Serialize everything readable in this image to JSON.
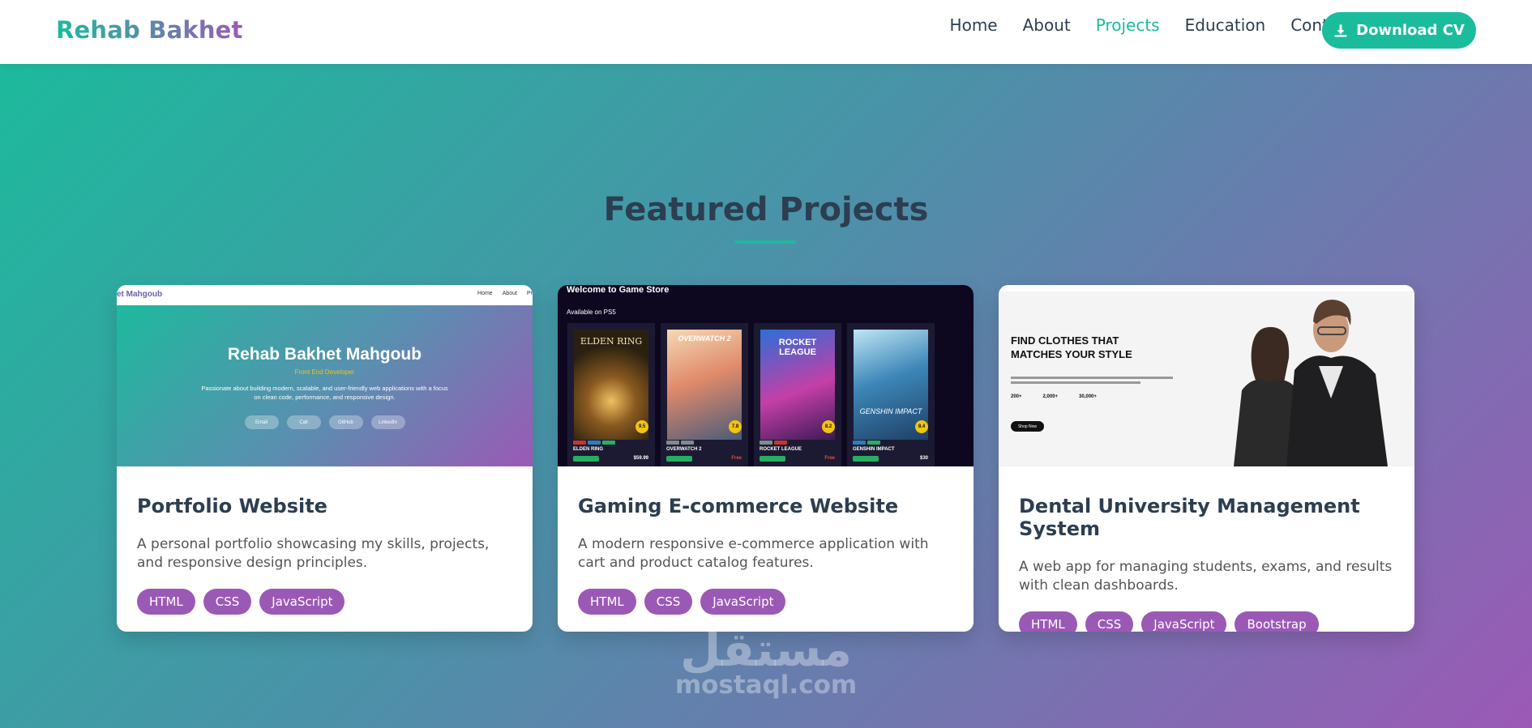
{
  "navbar": {
    "brand": "Rehab Bakhet",
    "links": [
      "Home",
      "About",
      "Projects",
      "Education",
      "Contact"
    ],
    "active_link": "Projects",
    "cv_button": "Download CV"
  },
  "section": {
    "title": "Featured Projects"
  },
  "projects": [
    {
      "title": "Portfolio Website",
      "description": "A personal portfolio showcasing my skills, projects, and responsive design principles.",
      "tags": [
        "HTML",
        "CSS",
        "JavaScript"
      ],
      "preview": {
        "brand": "et Mahgoub",
        "links": [
          "Home",
          "About",
          "Pr"
        ],
        "name": "Rehab Bakhet Mahgoub",
        "role": "Front End Developer",
        "text": "Passionate about building modern, scalable, and user-friendly web applications with a focus on clean code, performance, and responsive design.",
        "buttons": [
          "Email",
          "Call",
          "GitHub",
          "LinkedIn"
        ]
      }
    },
    {
      "title": "Gaming E-commerce Website",
      "description": "A modern responsive e-commerce application with cart and product catalog features.",
      "tags": [
        "HTML",
        "CSS",
        "JavaScript"
      ],
      "preview": {
        "title": "Welcome to Game Store",
        "subtitle": "Available on PS5",
        "games": [
          {
            "name": "ELDEN RING",
            "price": "$59.99",
            "rating": "9.5",
            "art": "ELDEN RING"
          },
          {
            "name": "OVERWATCH 2",
            "price": "Free",
            "rating": "7.8",
            "art": "OVERWATCH 2"
          },
          {
            "name": "ROCKET LEAGUE",
            "price": "Free",
            "rating": "8.2",
            "art": "ROCKET LEAGUE"
          },
          {
            "name": "GENSHIN IMPACT",
            "price": "$30",
            "rating": "8.4",
            "art": "GENSHIN IMPACT"
          }
        ]
      }
    },
    {
      "title": "Dental University Management System",
      "description": "A web app for managing students, exams, and results with clean dashboards.",
      "tags": [
        "HTML",
        "CSS",
        "JavaScript",
        "Bootstrap"
      ],
      "preview": {
        "headline": "FIND CLOTHES THAT MATCHES YOUR STYLE",
        "stats": [
          "200+",
          "2,000+",
          "30,000+"
        ],
        "button": "Shop Now"
      }
    }
  ],
  "watermark": {
    "arabic": "مستقل",
    "latin": "mostaql.com"
  },
  "colors": {
    "accent": "#1abc9c",
    "tag": "#9b59b6",
    "heading": "#2c3e50"
  }
}
